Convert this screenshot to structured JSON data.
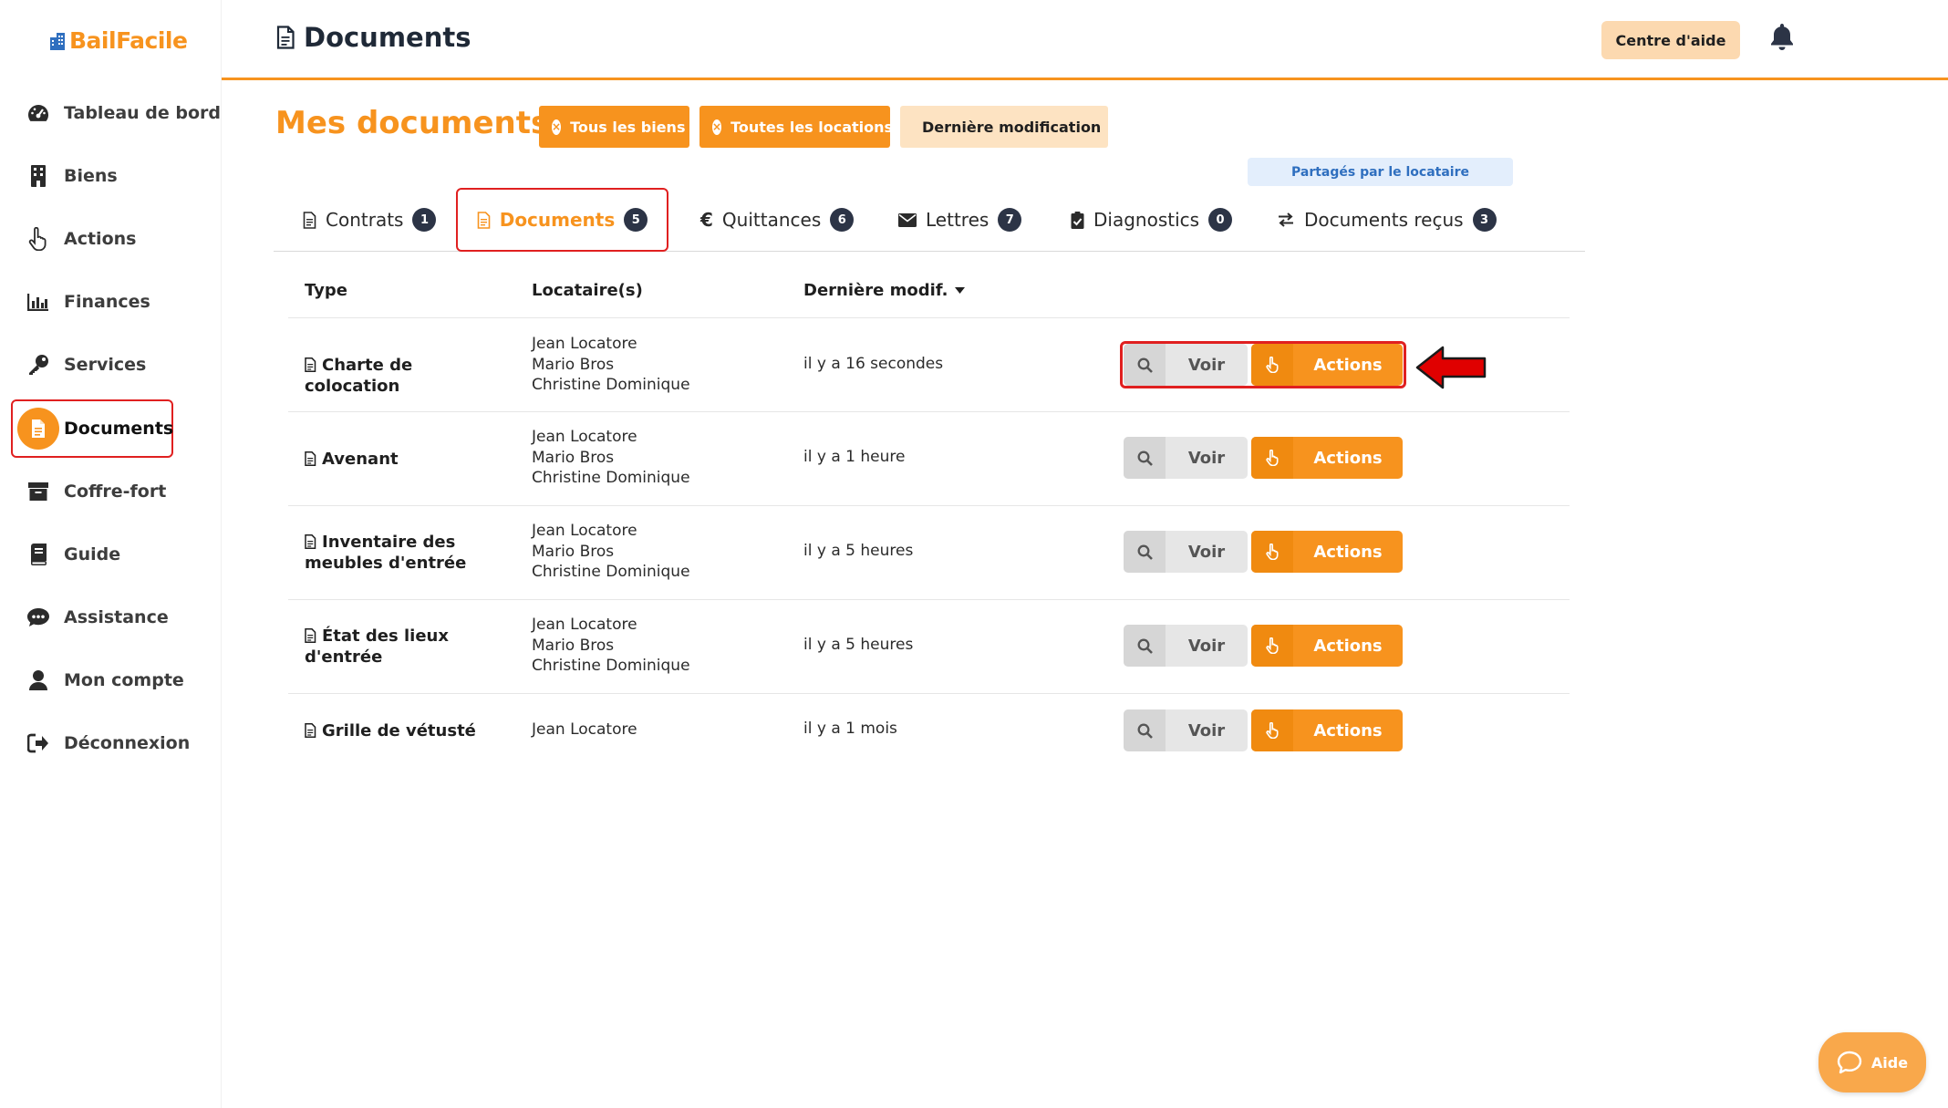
{
  "app": {
    "logo_text": "BailFacile",
    "accent_color": "#f7931e"
  },
  "sidebar": {
    "items": [
      {
        "label": "Tableau de bord",
        "icon": "dashboard-gauge-icon"
      },
      {
        "label": "Biens",
        "icon": "building-icon"
      },
      {
        "label": "Actions",
        "icon": "hand-pointer-icon"
      },
      {
        "label": "Finances",
        "icon": "bar-chart-icon"
      },
      {
        "label": "Services",
        "icon": "key-icon"
      },
      {
        "label": "Documents",
        "icon": "document-icon",
        "active": true
      },
      {
        "label": "Coffre-fort",
        "icon": "archive-icon"
      },
      {
        "label": "Guide",
        "icon": "book-icon"
      },
      {
        "label": "Assistance",
        "icon": "chat-icon"
      },
      {
        "label": "Mon compte",
        "icon": "user-icon"
      },
      {
        "label": "Déconnexion",
        "icon": "logout-icon"
      }
    ]
  },
  "header": {
    "title": "Documents",
    "help_button": "Centre d'aide"
  },
  "main": {
    "title": "Mes documents",
    "filters": {
      "all_properties": "Tous les biens",
      "all_rentals": "Toutes les locations",
      "last_modified": "Dernière modification"
    },
    "shared_tag": "Partagés par le locataire"
  },
  "tabs": [
    {
      "label": "Contrats",
      "count": "1",
      "icon": "file-icon"
    },
    {
      "label": "Documents",
      "count": "5",
      "icon": "file-text-icon",
      "active": true
    },
    {
      "label": "Quittances",
      "count": "6",
      "icon": "euro-icon"
    },
    {
      "label": "Lettres",
      "count": "7",
      "icon": "envelope-icon"
    },
    {
      "label": "Diagnostics",
      "count": "0",
      "icon": "clipboard-check-icon"
    },
    {
      "label": "Documents reçus",
      "count": "3",
      "icon": "exchange-icon"
    }
  ],
  "table": {
    "columns": {
      "type": "Type",
      "tenants": "Locataire(s)",
      "modified": "Dernière modif."
    },
    "view_label": "Voir",
    "actions_label": "Actions",
    "rows": [
      {
        "type": "Charte de colocation",
        "tenants": [
          "Jean Locatore",
          "Mario Bros",
          "Christine Dominique"
        ],
        "modified": "il y a 16 secondes"
      },
      {
        "type": "Avenant",
        "tenants": [
          "Jean Locatore",
          "Mario Bros",
          "Christine Dominique"
        ],
        "modified": "il y a 1 heure"
      },
      {
        "type": "Inventaire des meubles d'entrée",
        "tenants": [
          "Jean Locatore",
          "Mario Bros",
          "Christine Dominique"
        ],
        "modified": "il y a 5 heures"
      },
      {
        "type": "État des lieux d'entrée",
        "tenants": [
          "Jean Locatore",
          "Mario Bros",
          "Christine Dominique"
        ],
        "modified": "il y a 5 heures"
      },
      {
        "type": "Grille de vétusté",
        "tenants": [
          "Jean Locatore"
        ],
        "modified": "il y a 1 mois"
      }
    ]
  },
  "aide_button": "Aide"
}
